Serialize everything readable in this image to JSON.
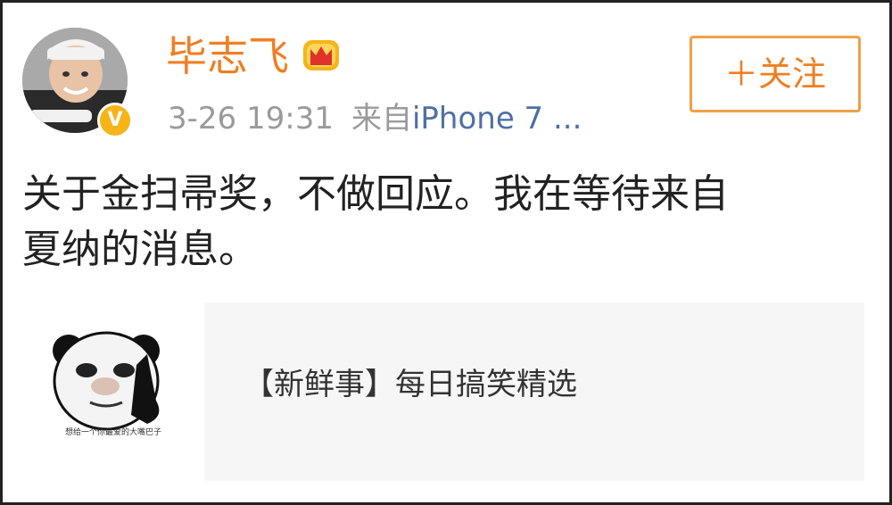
{
  "post": {
    "username": "毕志飞",
    "verified_badge": "V",
    "time": "3-26 19:31",
    "source_prefix": "来自",
    "source_device": "iPhone 7 ...",
    "follow_label": "＋关注",
    "text": "关于金扫帚奖，不做回应。我在等待来自\n夏纳的消息。"
  },
  "card": {
    "title": "【新鲜事】每日搞笑精选",
    "thumb_caption": "想给一个你最爱的大嘴巴子"
  },
  "colors": {
    "username": "#ef7f22",
    "verified": "#f6b418",
    "link": "#4f6fa6",
    "meta": "#9a9a9a",
    "follow_border": "#f0a04a"
  },
  "icons": {
    "crown": "crown-icon",
    "verified": "verified-v-icon"
  }
}
